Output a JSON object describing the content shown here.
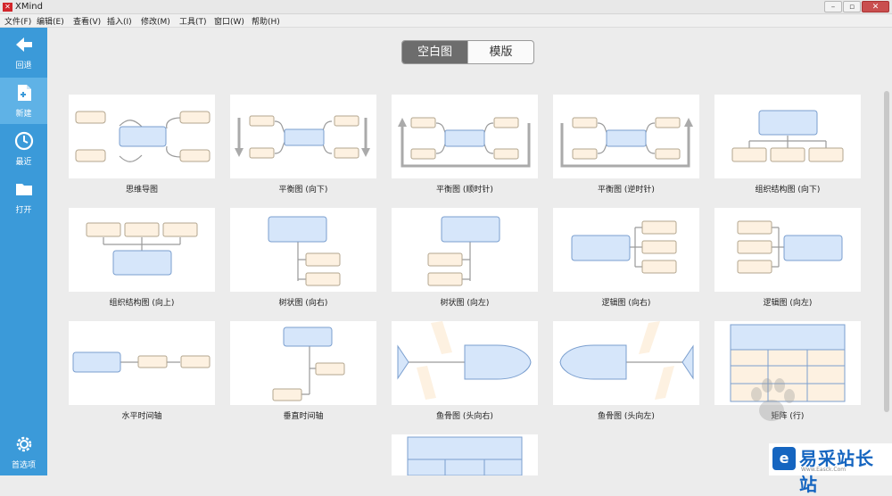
{
  "window": {
    "title": "XMind",
    "subtitle": "",
    "controls": {
      "minimize": "–",
      "restore": "▫",
      "close": "✕"
    }
  },
  "menu": [
    "文件(F)",
    "编辑(E)",
    "查看(V)",
    "插入(I)",
    "修改(M)",
    "工具(T)",
    "窗口(W)",
    "帮助(H)"
  ],
  "sidebar": {
    "items": [
      {
        "label": "回退",
        "icon": "back-arrow-icon"
      },
      {
        "label": "新建",
        "icon": "new-file-icon"
      },
      {
        "label": "最近",
        "icon": "clock-icon"
      },
      {
        "label": "打开",
        "icon": "folder-icon"
      }
    ],
    "bottom": {
      "label": "首选项",
      "icon": "gear-icon"
    }
  },
  "tabs": {
    "blank": "空白图",
    "template": "模版",
    "selected": "空白图"
  },
  "templates": [
    "思维导图",
    "平衡图 (向下)",
    "平衡图 (顺时针)",
    "平衡图 (逆时针)",
    "组织结构图 (向下)",
    "组织结构图 (向上)",
    "树状图 (向右)",
    "树状图 (向左)",
    "逻辑图 (向右)",
    "逻辑图 (向左)",
    "水平时间轴",
    "垂直时间轴",
    "鱼骨图 (头向右)",
    "鱼骨图 (头向左)",
    "矩阵 (行)",
    ""
  ],
  "watermark": {
    "name": "易采站长站",
    "url": "Www.Easck.Com"
  },
  "colors": {
    "sidebar": "#3b9ad9",
    "sidebar_active": "#5fb2e6",
    "topic": "#d6e6fa",
    "topic_border": "#7b9fcf",
    "subtopic": "#fdf1e1",
    "subtopic_border": "#b3a68f",
    "connector": "#9a9a9a"
  }
}
